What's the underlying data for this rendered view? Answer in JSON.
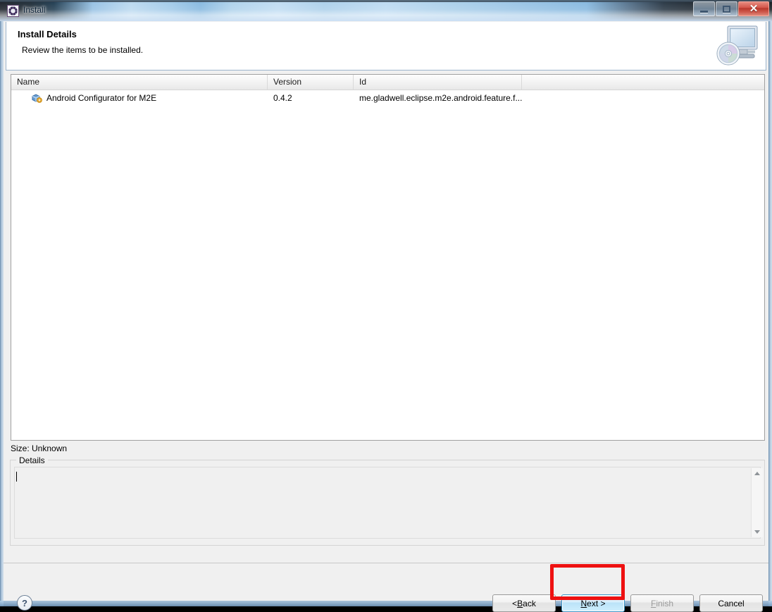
{
  "window": {
    "title": "Install",
    "app_icon": "eclipse-gear-icon",
    "controls": {
      "minimize": "minimize-button",
      "maximize": "restore-button",
      "close": "close-button",
      "close_glyph": "✕"
    },
    "accent_close": "#c0392b",
    "accent_focus": "#3c97c8"
  },
  "header": {
    "title": "Install Details",
    "subtitle": "Review the items to be installed.",
    "banner_icon": "monitor-with-disc-icon"
  },
  "table": {
    "columns": [
      "Name",
      "Version",
      "Id",
      ""
    ],
    "rows": [
      {
        "icon": "feature-plugin-icon",
        "name": "Android Configurator for M2E",
        "version": "0.4.2",
        "id": "me.gladwell.eclipse.m2e.android.feature.f...",
        "extra": ""
      }
    ]
  },
  "size": {
    "label": "Size: Unknown"
  },
  "details": {
    "legend": "Details",
    "content": "",
    "scrollbar": {
      "up": "scroll-up-arrow-icon",
      "down": "scroll-down-arrow-icon"
    }
  },
  "footer": {
    "help_glyph": "?",
    "buttons": [
      {
        "name": "back",
        "prefix": "< ",
        "accel": "B",
        "suffix": "ack",
        "enabled": true,
        "focused": false
      },
      {
        "name": "next",
        "prefix": "",
        "accel": "N",
        "suffix": "ext >",
        "enabled": true,
        "focused": true
      },
      {
        "name": "finish",
        "prefix": "",
        "accel": "F",
        "suffix": "inish",
        "enabled": false,
        "focused": false
      },
      {
        "name": "cancel",
        "prefix": "",
        "accel": "",
        "suffix": "Cancel",
        "enabled": true,
        "focused": false
      }
    ]
  },
  "annotation": {
    "target": "next-button",
    "color": "#ee1111"
  }
}
